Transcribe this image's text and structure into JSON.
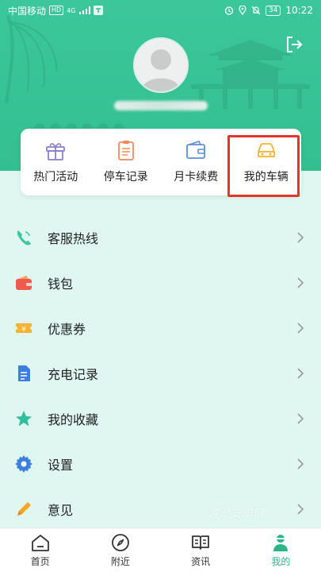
{
  "status_bar": {
    "carrier": "中国移动",
    "hd_badge": "HD",
    "network": "4G",
    "battery": "34",
    "time": "10:22"
  },
  "quick_actions": [
    {
      "label": "热门活动",
      "icon": "gift-icon"
    },
    {
      "label": "停车记录",
      "icon": "clipboard-icon"
    },
    {
      "label": "月卡续费",
      "icon": "wallet-card-icon"
    },
    {
      "label": "我的车辆",
      "icon": "car-icon"
    }
  ],
  "menu": [
    {
      "label": "客服热线",
      "icon": "phone-icon"
    },
    {
      "label": "钱包",
      "icon": "wallet-icon"
    },
    {
      "label": "优惠券",
      "icon": "coupon-icon"
    },
    {
      "label": "充电记录",
      "icon": "document-icon"
    },
    {
      "label": "我的收藏",
      "icon": "star-icon"
    },
    {
      "label": "设置",
      "icon": "gear-icon"
    },
    {
      "label": "意见",
      "icon": "pencil-icon"
    }
  ],
  "watermark": "趣动安卓网",
  "bottom_nav": [
    {
      "label": "首页",
      "icon": "home-icon"
    },
    {
      "label": "附近",
      "icon": "compass-icon"
    },
    {
      "label": "资讯",
      "icon": "book-icon"
    },
    {
      "label": "我的",
      "icon": "person-icon",
      "active": true
    }
  ],
  "colors": {
    "header_green": "#3cc79a",
    "accent_green": "#2bb584",
    "highlight_red": "#e3352d",
    "page_bg": "#dff7f0"
  }
}
